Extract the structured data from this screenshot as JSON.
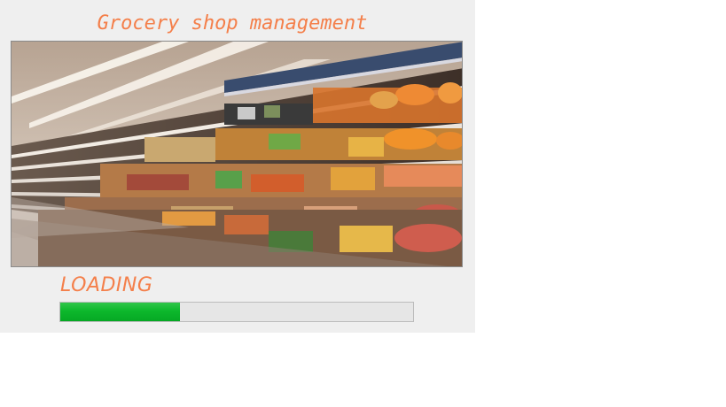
{
  "header": {
    "title": "Grocery shop management"
  },
  "banner": {
    "image_name": "supermarket-shelves-image"
  },
  "loading": {
    "label": "LOADING",
    "progress": 0.34,
    "bar_color": "#06b025",
    "track_color": "#e6e6e6"
  },
  "colors": {
    "accent": "#f47f4a",
    "window_bg": "#efefef"
  }
}
